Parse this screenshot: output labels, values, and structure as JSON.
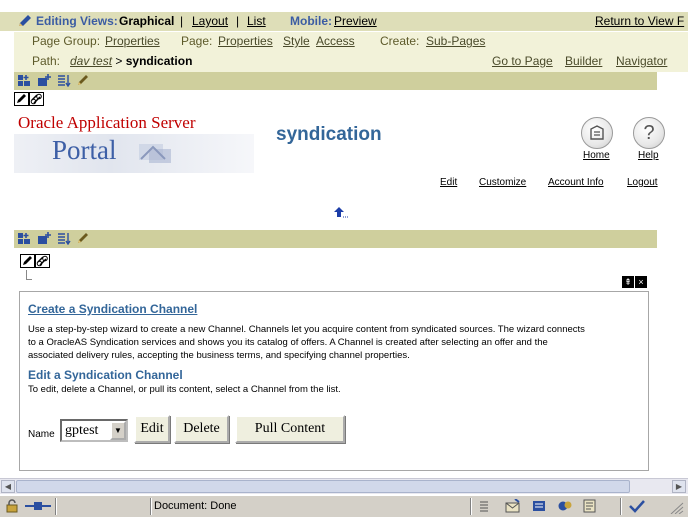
{
  "edit_bar": {
    "editing_views_label": "Editing Views:",
    "graphical_label": "Graphical",
    "layout_label": "Layout",
    "list_label": "List",
    "mobile_label": "Mobile:",
    "preview_label": "Preview",
    "return_label": "Return to View F"
  },
  "page_bar": {
    "page_group_label": "Page Group:",
    "page_group_link": "Properties",
    "page_label": "Page:",
    "page_properties_link": "Properties",
    "style_link": "Style",
    "access_link": "Access",
    "create_label": "Create:",
    "subpages_link": "Sub-Pages"
  },
  "path_bar": {
    "path_label": "Path:",
    "path_root": "dav test",
    "path_sep": " > ",
    "path_current": "syndication",
    "goto_page_link": "Go to Page",
    "builder_link": "Builder",
    "navigator_link": "Navigator"
  },
  "header": {
    "logo_top": "Oracle Application Server",
    "logo_portal": "Portal",
    "page_title": "syndication",
    "home_label": "Home",
    "help_label": "Help",
    "help_glyph": "?",
    "links": [
      "Edit",
      "Customize",
      "Account Info",
      "Logout"
    ]
  },
  "portlet": {
    "collapse_glyph": "⇞",
    "close_glyph": "×",
    "create_heading": "Create a Syndication Channel",
    "create_line1": "Use a step-by-step wizard to create a new Channel. Channels let you acquire content from syndicated sources. The wizard connects",
    "create_line2": "to a OracleAS Syndication services and shows you its catalog of offers.  A Channel is created after selecting an offer and the",
    "create_line3": "associated delivery rules, accepting the business terms, and specifying channel properties.",
    "edit_heading": "Edit a Syndication Channel",
    "edit_line": "To edit, delete a Channel, or pull its content, select a Channel from the list.",
    "name_label": "Name",
    "selected_channel": "gptest",
    "edit_button": "Edit",
    "delete_button": "Delete",
    "pull_button": "Pull Content"
  },
  "status_bar": {
    "text": "Document: Done"
  },
  "colors": {
    "bar_olive": "#dedeb8",
    "bar_light": "#f2f2d9",
    "toolbar_strip": "#cfcf9d",
    "title_blue": "#336699",
    "logo_red": "#c00000"
  }
}
